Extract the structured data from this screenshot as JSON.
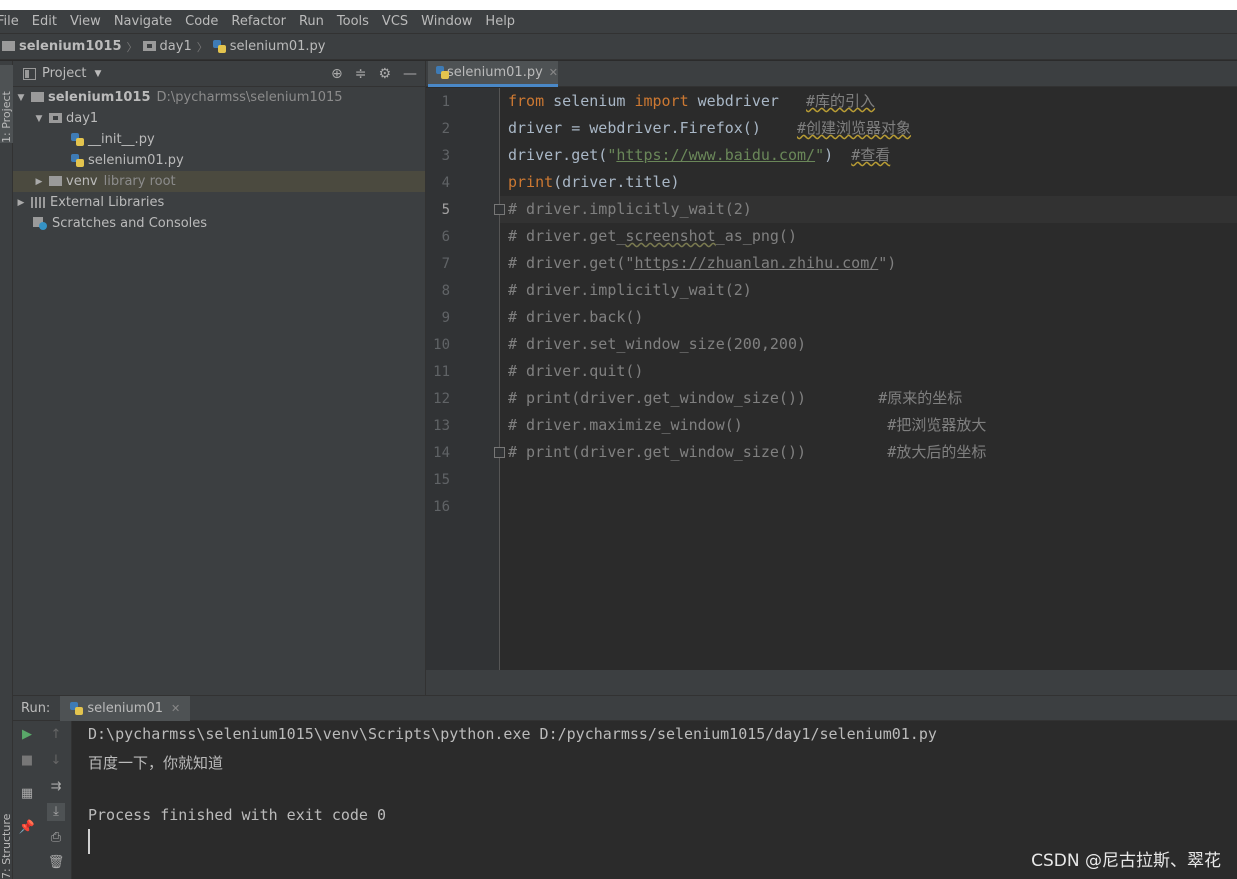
{
  "menu": [
    "File",
    "Edit",
    "View",
    "Navigate",
    "Code",
    "Refactor",
    "Run",
    "Tools",
    "VCS",
    "Window",
    "Help"
  ],
  "breadcrumb": {
    "project": "selenium1015",
    "folder": "day1",
    "file": "selenium01.py"
  },
  "left_stripe": {
    "project_tab": "1: Project",
    "structure_tab": "7: Structure"
  },
  "project_panel": {
    "title": "Project",
    "tree": {
      "root_name": "selenium1015",
      "root_path": "D:\\pycharmss\\selenium1015",
      "day1": "day1",
      "init_file": "__init__.py",
      "selenium_file": "selenium01.py",
      "venv": "venv",
      "venv_note": "library root",
      "external": "External Libraries",
      "scratches": "Scratches and Consoles"
    }
  },
  "editor": {
    "tab": "selenium01.py",
    "line_numbers": [
      "1",
      "2",
      "3",
      "4",
      "5",
      "6",
      "7",
      "8",
      "9",
      "10",
      "11",
      "12",
      "13",
      "14",
      "15",
      "16"
    ],
    "lines": {
      "l1_kw1": "from",
      "l1_mod": " selenium ",
      "l1_kw2": "import",
      "l1_rest": " webdriver   ",
      "l1_cmt": "#库的引入",
      "l2_code": "driver = webdriver.Firefox()    ",
      "l2_cmt": "#创建浏览器对象",
      "l3_pre": "driver.get(",
      "l3_q1": "\"",
      "l3_url": "https://www.baidu.com/",
      "l3_q2": "\"",
      "l3_post": ")  ",
      "l3_cmt": "#查看",
      "l4_kw": "print",
      "l4_rest": "(driver.title)",
      "l5": "# driver.implicitly_wait(2)",
      "l6_pre": "# driver.get_",
      "l6_u": "screenshot",
      "l6_post": "_as_png()",
      "l7_pre": "# driver.get(\"",
      "l7_url": "https://zhuanlan.zhihu.com/",
      "l7_post": "\")",
      "l8": "# driver.implicitly_wait(2)",
      "l9": "# driver.back()",
      "l10": "# driver.set_window_size(200,200)",
      "l11": "# driver.quit()",
      "l12": "# print(driver.get_window_size())        #原来的坐标",
      "l13": "# driver.maximize_window()                #把浏览器放大",
      "l14": "# print(driver.get_window_size())         #放大后的坐标"
    }
  },
  "run": {
    "label": "Run:",
    "tab": "selenium01",
    "console": [
      "D:\\pycharmss\\selenium1015\\venv\\Scripts\\python.exe D:/pycharmss/selenium1015/day1/selenium01.py",
      "百度一下，你就知道",
      "",
      "Process finished with exit code 0"
    ]
  },
  "watermark": "CSDN @尼古拉斯、翠花",
  "colors": {
    "keyword": "#cc7832",
    "comment": "#808080",
    "string": "#6a8759",
    "text": "#a9b7c6",
    "tab_underline": "#4a88c7"
  }
}
